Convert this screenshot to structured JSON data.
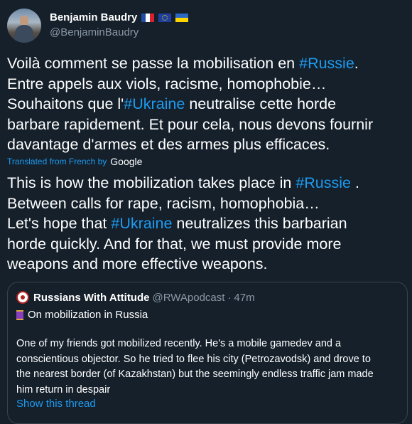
{
  "author": {
    "display_name": "Benjamin Baudry",
    "handle": "@BenjaminBaudry",
    "flags": [
      "france-flag-icon",
      "eu-flag-icon",
      "ukraine-flag-icon"
    ]
  },
  "tweet": {
    "line1_a": "Voilà comment se passe la mobilisation en ",
    "line1_tag": "#Russie",
    "line1_b": ".\nEntre appels aux viols, racisme, homophobie…\nSouhaitons que l'",
    "line2_tag": "#Ukraine",
    "line2_b": " neutralise cette horde\nbarbare rapidement. Et pour cela, nous devons fournir\ndavantage d'armes et des armes plus efficaces."
  },
  "translation_meta": {
    "label": "Translated from French by",
    "provider": "Google"
  },
  "translation": {
    "t1_a": "This is how the mobilization takes place in ",
    "t1_tag": "#Russie",
    "t1_b": " .\nBetween calls for rape, racism, homophobia…\nLet's hope that ",
    "t2_tag": "#Ukraine",
    "t2_b": " neutralizes this barbarian\nhorde quickly. And for that, we must provide more\nweapons and more effective weapons."
  },
  "quote": {
    "name": "Russians With Attitude",
    "handle": "@RWApodcast",
    "separator": "·",
    "time": "47m",
    "subtitle": "On mobilization in Russia",
    "body": "One of my friends got mobilized recently. He's a mobile gamedev and a\nconscientious objector. So he tried to flee his city (Petrozavodsk) and drove to\nthe nearest border (of Kazakhstan) but the seemingly endless traffic jam made\nhim return in despair",
    "link": "Show this thread"
  },
  "colors": {
    "background": "#15202b",
    "accent": "#1d9bf0",
    "secondary_text": "#8b98a5",
    "border": "#38444d"
  }
}
